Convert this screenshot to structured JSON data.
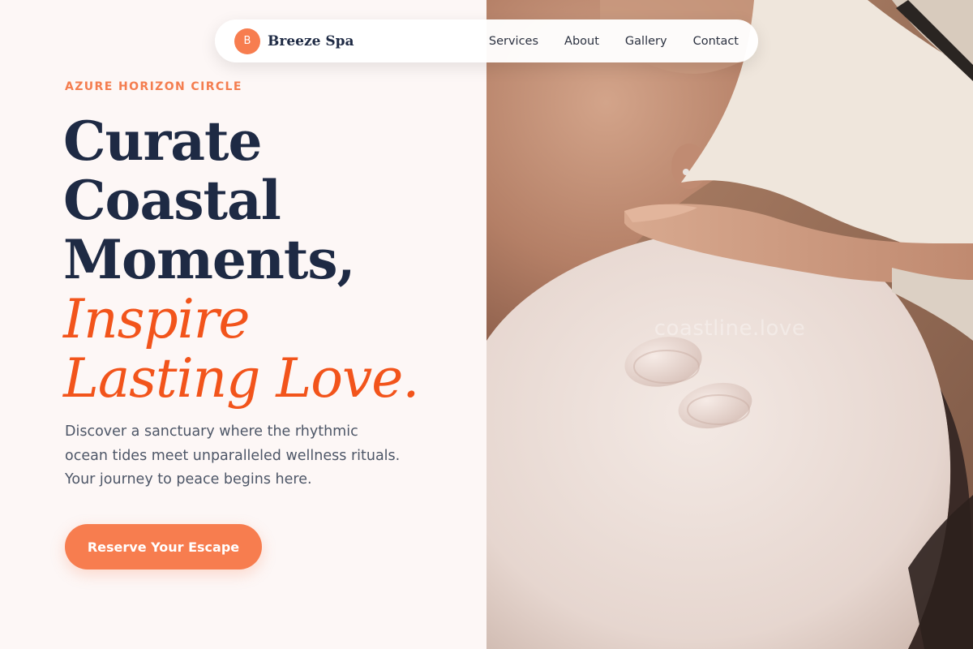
{
  "nav": {
    "brand_initial": "B",
    "brand_name": "Breeze Spa",
    "links": [
      {
        "label": "Services"
      },
      {
        "label": "About"
      },
      {
        "label": "Gallery"
      },
      {
        "label": "Contact"
      }
    ]
  },
  "hero": {
    "eyebrow": "AZURE HORIZON CIRCLE",
    "headline_lines": [
      "Curate",
      "Coastal",
      "Moments,"
    ],
    "accent_lines": [
      "Inspire",
      "Lasting Love."
    ],
    "body": "Discover a sanctuary where the rhythmic ocean tides meet unparalleled wellness rituals. Your journey to peace begins here.",
    "cta_label": "Reserve Your Escape"
  },
  "photo": {
    "watermark": "coastline.love"
  },
  "colors": {
    "accent": "#f77d4f",
    "accent_text": "#f2541b",
    "heading": "#1e2a44",
    "body_text": "#4d5667",
    "background": "#fdf7f6"
  }
}
